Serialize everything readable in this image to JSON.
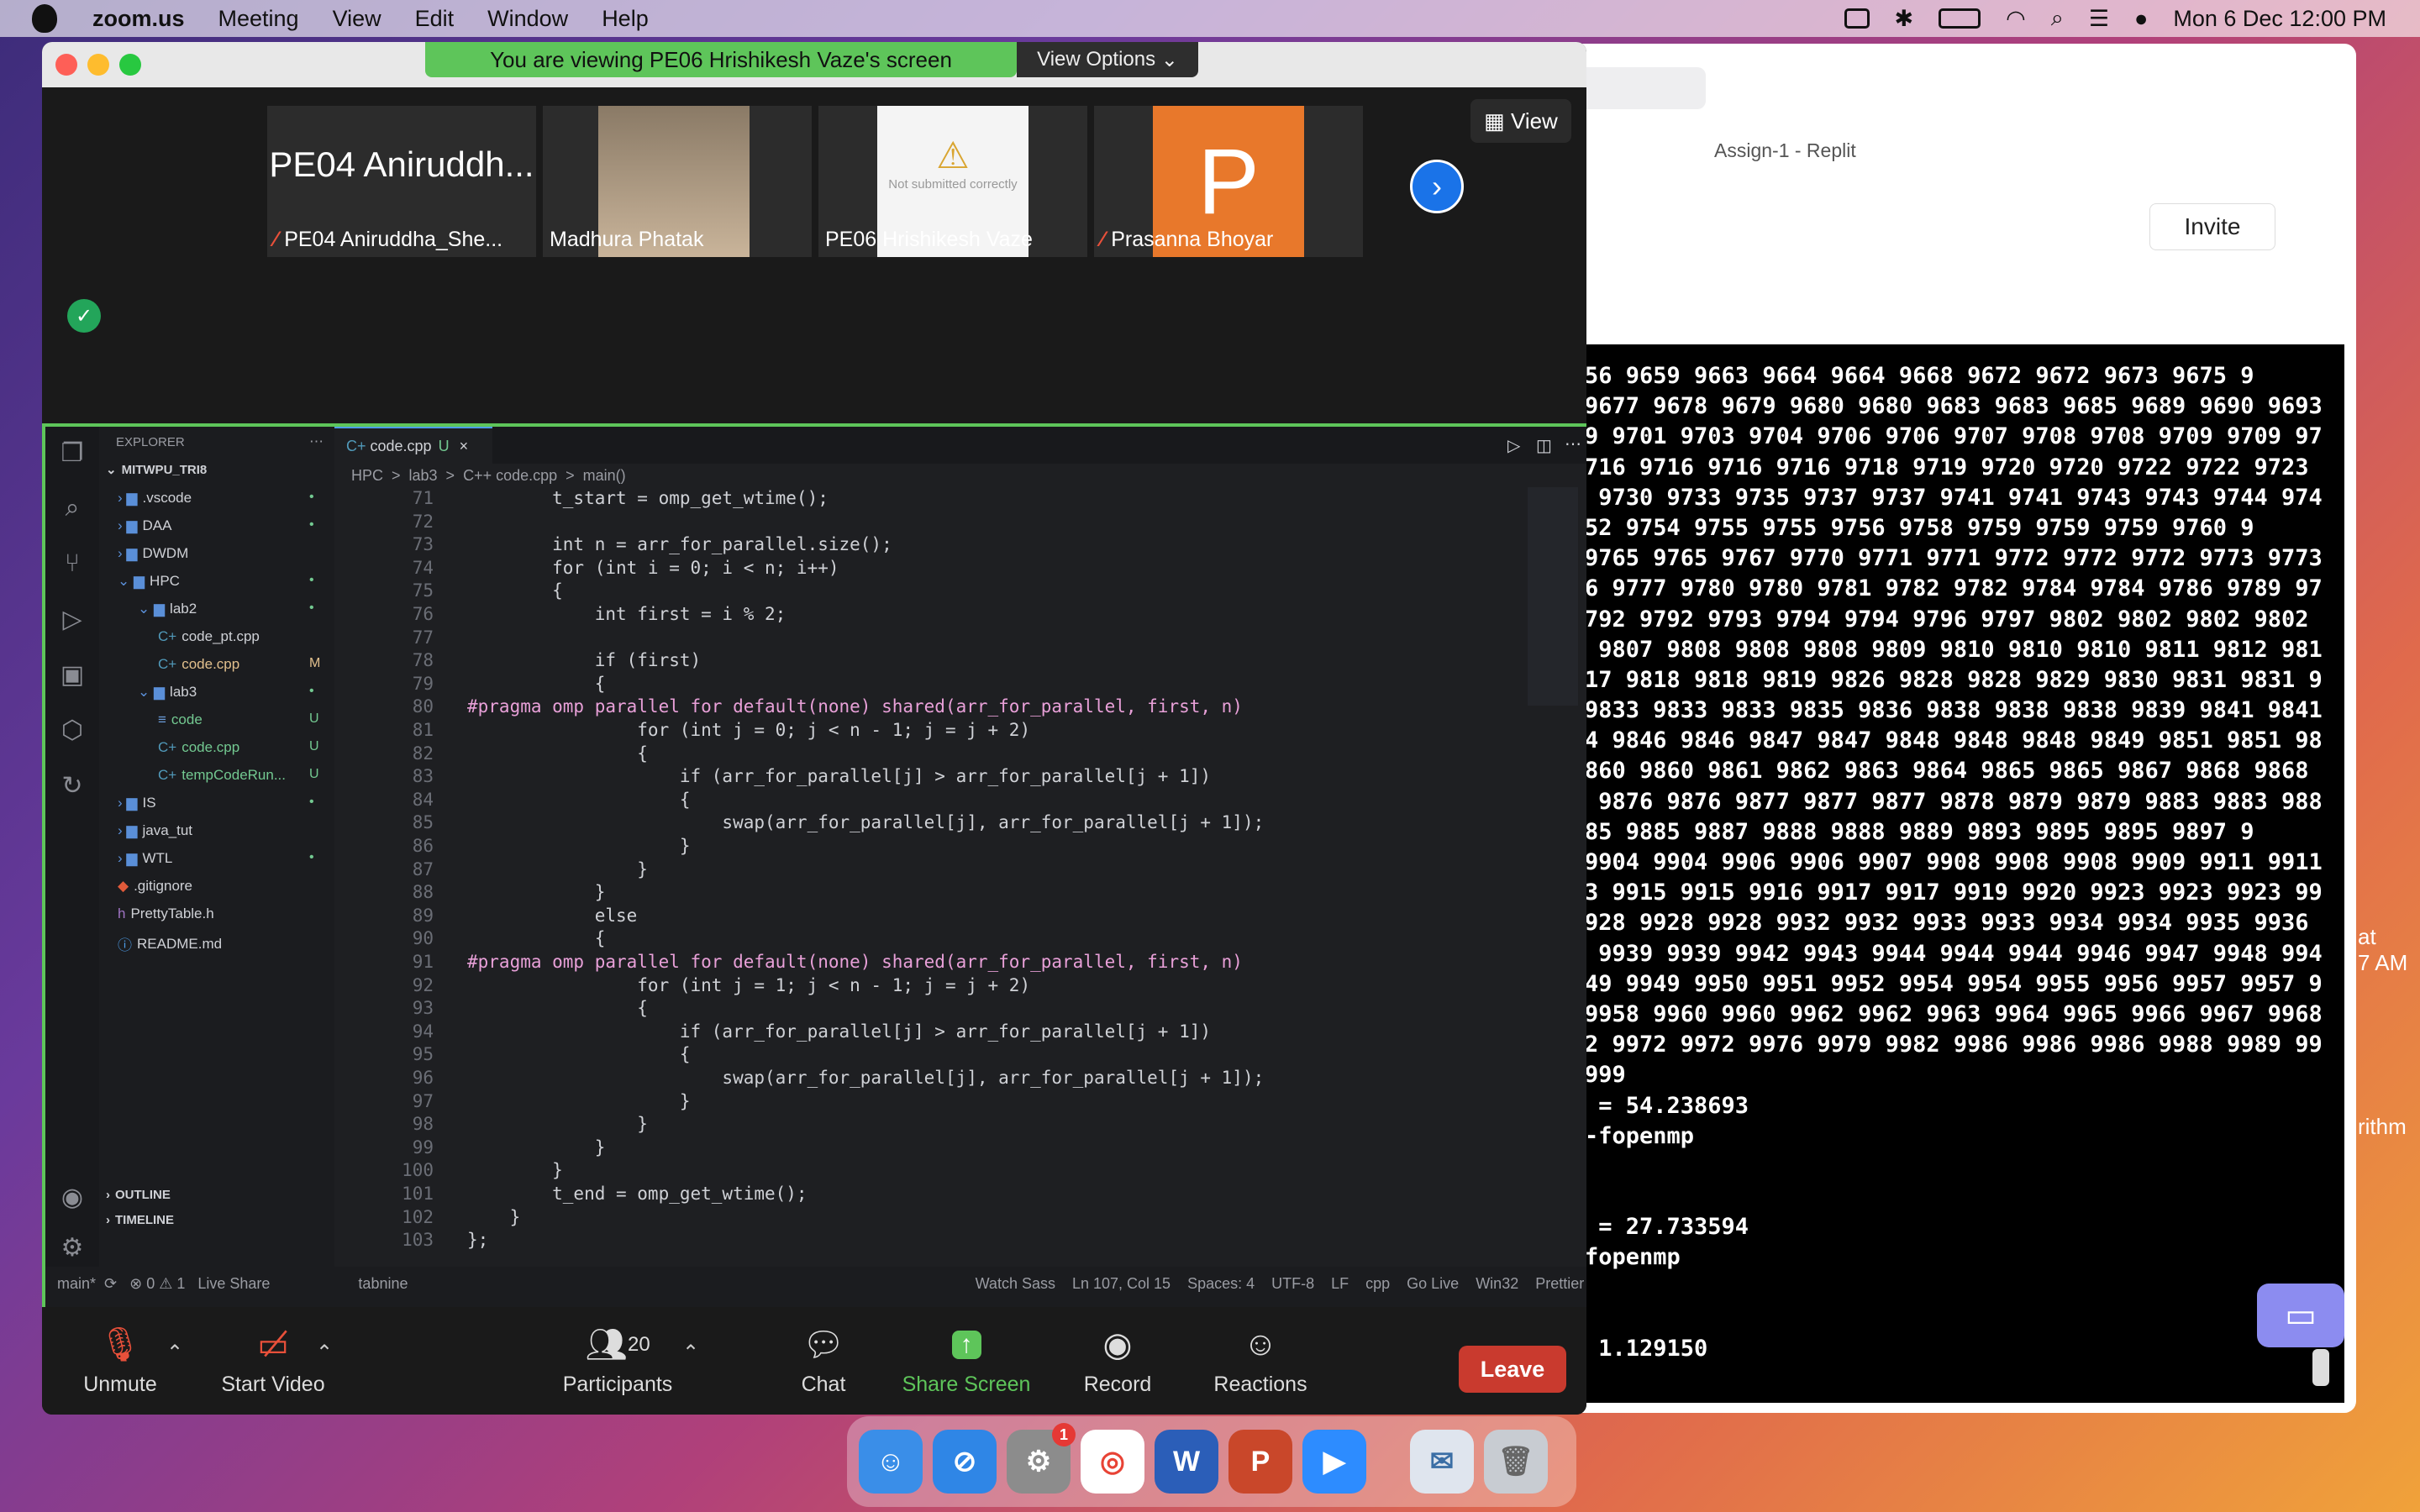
{
  "menubar": {
    "app": "zoom.us",
    "items": [
      "Meeting",
      "View",
      "Edit",
      "Window",
      "Help"
    ],
    "datetime": "Mon 6 Dec  12:00 PM"
  },
  "safari": {
    "tab_title": "Assign-1 - Replit",
    "invite": "Invite",
    "terminal_lines": [
      "56 9659 9663 9664 9664 9668 9672 9672 9673 9675 9",
      "9677 9678 9679 9680 9680 9683 9683 9685 9689 9690 9693",
      "9 9701 9703 9704 9706 9706 9707 9708 9708 9709 9709 97",
      "716 9716 9716 9716 9718 9719 9720 9720 9722 9722 9723",
      " 9730 9733 9735 9737 9737 9741 9741 9743 9743 9744 974",
      "52 9754 9755 9755 9756 9758 9759 9759 9759 9760 9",
      "9765 9765 9767 9770 9771 9771 9772 9772 9772 9773 9773",
      "6 9777 9780 9780 9781 9782 9782 9784 9784 9786 9789 97",
      "792 9792 9793 9794 9794 9796 9797 9802 9802 9802 9802",
      " 9807 9808 9808 9808 9809 9810 9810 9810 9811 9812 981",
      "17 9818 9818 9819 9826 9828 9828 9829 9830 9831 9831 9",
      "9833 9833 9833 9835 9836 9838 9838 9838 9839 9841 9841",
      "4 9846 9846 9847 9847 9848 9848 9848 9849 9851 9851 98",
      "860 9860 9861 9862 9863 9864 9865 9865 9867 9868 9868",
      " 9876 9876 9877 9877 9877 9878 9879 9879 9883 9883 988",
      "85 9885 9887 9888 9888 9889 9893 9895 9895 9897 9",
      "9904 9904 9906 9906 9907 9908 9908 9908 9909 9911 9911",
      "3 9915 9915 9916 9917 9917 9919 9920 9923 9923 9923 99",
      "928 9928 9928 9932 9932 9933 9933 9934 9934 9935 9936",
      " 9939 9939 9942 9943 9944 9944 9944 9946 9947 9948 994",
      "49 9949 9950 9951 9952 9954 9954 9955 9956 9957 9957 9",
      "9958 9960 9960 9962 9962 9963 9964 9965 9966 9967 9968",
      "2 9972 9972 9976 9979 9982 9986 9986 9986 9988 9989 99",
      "999",
      " = 54.238693",
      "-fopenmp",
      "",
      "",
      " = 27.733594",
      "fopenmp",
      "",
      "",
      " 1.129150"
    ],
    "side_text_a": "at\n7 AM",
    "side_text_b": "rithm"
  },
  "zoom": {
    "banner": "You are viewing PE06 Hrishikesh Vaze's screen",
    "view_options": "View Options",
    "view_button": "View",
    "participants": [
      {
        "big": "PE04 Aniruddh...",
        "name": "PE04 Aniruddha_She...",
        "muted": true
      },
      {
        "big": "",
        "name": "Madhura Phatak",
        "muted": false
      },
      {
        "big": "Not submitted correctly",
        "name": "PE06 Hrishikesh Vaze",
        "muted": false
      },
      {
        "big": "P",
        "name": "Prasanna Bhoyar",
        "muted": true
      }
    ],
    "toolbar": {
      "unmute": "Unmute",
      "start_video": "Start Video",
      "participants": "Participants",
      "participant_count": "20",
      "chat": "Chat",
      "share_screen": "Share Screen",
      "record": "Record",
      "reactions": "Reactions",
      "leave": "Leave"
    }
  },
  "vscode": {
    "explorer_title": "EXPLORER",
    "workspace": "MITWPU_TRI8",
    "tree": [
      {
        "label": ".vscode",
        "kind": "folder",
        "indent": 0,
        "status": "•"
      },
      {
        "label": "DAA",
        "kind": "folder",
        "indent": 0,
        "status": "•"
      },
      {
        "label": "DWDM",
        "kind": "folder",
        "indent": 0,
        "status": ""
      },
      {
        "label": "HPC",
        "kind": "folder-open",
        "indent": 0,
        "status": "•"
      },
      {
        "label": "lab2",
        "kind": "folder-open",
        "indent": 1,
        "status": "•"
      },
      {
        "label": "code_pt.cpp",
        "kind": "cpp",
        "indent": 2,
        "status": ""
      },
      {
        "label": "code.cpp",
        "kind": "cpp",
        "indent": 2,
        "status": "M"
      },
      {
        "label": "lab3",
        "kind": "folder-open",
        "indent": 1,
        "status": "•"
      },
      {
        "label": "code",
        "kind": "file",
        "indent": 2,
        "status": "U"
      },
      {
        "label": "code.cpp",
        "kind": "cpp",
        "indent": 2,
        "status": "U"
      },
      {
        "label": "tempCodeRun...",
        "kind": "cpp",
        "indent": 2,
        "status": "U"
      },
      {
        "label": "IS",
        "kind": "folder",
        "indent": 0,
        "status": "•"
      },
      {
        "label": "java_tut",
        "kind": "folder",
        "indent": 0,
        "status": ""
      },
      {
        "label": "WTL",
        "kind": "folder",
        "indent": 0,
        "status": "•"
      },
      {
        "label": ".gitignore",
        "kind": "git",
        "indent": 0,
        "status": ""
      },
      {
        "label": "PrettyTable.h",
        "kind": "h",
        "indent": 0,
        "status": ""
      },
      {
        "label": "README.md",
        "kind": "md",
        "indent": 0,
        "status": ""
      }
    ],
    "outline": "OUTLINE",
    "timeline": "TIMELINE",
    "tab": "code.cpp",
    "tab_status": "U",
    "breadcrumb": "HPC  >  lab3  >  C++ code.cpp  >  main()",
    "code_lines": [
      {
        "n": "71",
        "t": "        t_start = omp_get_wtime();"
      },
      {
        "n": "72",
        "t": ""
      },
      {
        "n": "73",
        "t": "        int n = arr_for_parallel.size();"
      },
      {
        "n": "74",
        "t": "        for (int i = 0; i < n; i++)"
      },
      {
        "n": "75",
        "t": "        {"
      },
      {
        "n": "76",
        "t": "            int first = i % 2;"
      },
      {
        "n": "77",
        "t": ""
      },
      {
        "n": "78",
        "t": "            if (first)"
      },
      {
        "n": "79",
        "t": "            {"
      },
      {
        "n": "80",
        "t": "#pragma omp parallel for default(none) shared(arr_for_parallel, first, n)"
      },
      {
        "n": "81",
        "t": "                for (int j = 0; j < n - 1; j = j + 2)"
      },
      {
        "n": "82",
        "t": "                {"
      },
      {
        "n": "83",
        "t": "                    if (arr_for_parallel[j] > arr_for_parallel[j + 1])"
      },
      {
        "n": "84",
        "t": "                    {"
      },
      {
        "n": "85",
        "t": "                        swap(arr_for_parallel[j], arr_for_parallel[j + 1]);"
      },
      {
        "n": "86",
        "t": "                    }"
      },
      {
        "n": "87",
        "t": "                }"
      },
      {
        "n": "88",
        "t": "            }"
      },
      {
        "n": "89",
        "t": "            else"
      },
      {
        "n": "90",
        "t": "            {"
      },
      {
        "n": "91",
        "t": "#pragma omp parallel for default(none) shared(arr_for_parallel, first, n)"
      },
      {
        "n": "92",
        "t": "                for (int j = 1; j < n - 1; j = j + 2)"
      },
      {
        "n": "93",
        "t": "                {"
      },
      {
        "n": "94",
        "t": "                    if (arr_for_parallel[j] > arr_for_parallel[j + 1])"
      },
      {
        "n": "95",
        "t": "                    {"
      },
      {
        "n": "96",
        "t": "                        swap(arr_for_parallel[j], arr_for_parallel[j + 1]);"
      },
      {
        "n": "97",
        "t": "                    }"
      },
      {
        "n": "98",
        "t": "                }"
      },
      {
        "n": "99",
        "t": "            }"
      },
      {
        "n": "100",
        "t": "        }"
      },
      {
        "n": "101",
        "t": "        t_end = omp_get_wtime();"
      },
      {
        "n": "102",
        "t": "    }"
      },
      {
        "n": "103",
        "t": "};"
      }
    ],
    "statusbar": "main*  ⟳   ⊗ 0 ⚠ 1   Live Share                     tabnine                                                                                                                                       Watch Sass    Ln 107, Col 15    Spaces: 4    UTF-8    LF    cpp    Go Live    Win32    Prettier"
  },
  "colors": {
    "zoom_green": "#5ec55a",
    "leave_red": "#c93a2e",
    "vscode_bg": "#1e1f22"
  }
}
